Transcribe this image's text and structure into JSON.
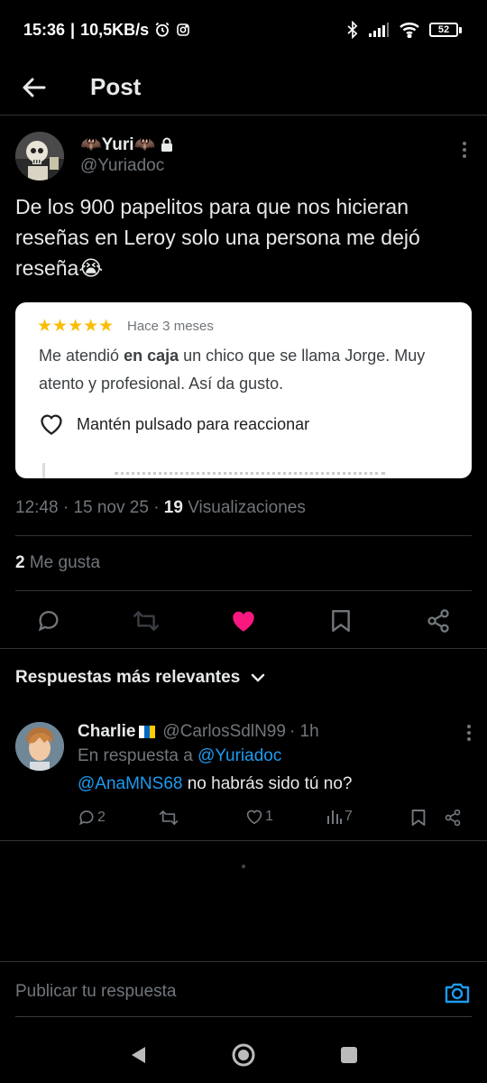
{
  "status_bar": {
    "time": "15:36",
    "separator": "|",
    "network_speed": "10,5KB/s",
    "battery_level": "52",
    "icons": [
      "alarm-icon",
      "instagram-icon",
      "bluetooth-icon",
      "signal-icon",
      "wifi-icon",
      "battery-icon"
    ]
  },
  "header": {
    "title": "Post",
    "back_icon": "arrow-left-icon"
  },
  "post": {
    "author_name": "🦇Yuri🦇",
    "author_handle": "@Yuriadoc",
    "text": "De los 900 papelitos para que nos hicieran reseñas en Leroy solo una persona me dejó reseña😭",
    "embed": {
      "stars": "★★★★★",
      "age": "Hace 3 meses",
      "review_before": "Me atendió ",
      "review_bold": "en caja",
      "review_after": " un chico que se llama Jorge. Muy atento y profesional. Así da gusto.",
      "react_label": "Mantén pulsado para reaccionar"
    },
    "time": "12:48",
    "date": "15 nov 25",
    "views_count": "19",
    "views_label": "Visualizaciones",
    "likes_count": "2",
    "likes_label": "Me gusta",
    "accent_color": "#1d9bf0",
    "liked_color": "#f91880"
  },
  "replies": {
    "sort_label": "Respuestas más relevantes",
    "items": [
      {
        "name": "Charlie",
        "handle": "@CarlosSdlN99",
        "age": "· 1h",
        "reply_to_label": "En respuesta a",
        "reply_to_handle": "@Yuriadoc",
        "mention": "@AnaMNS68",
        "text": " no habrás sido tú no?",
        "reply_count": "2",
        "like_count": "1",
        "view_count": "7"
      }
    ]
  },
  "compose": {
    "placeholder": "Publicar tu respuesta"
  }
}
